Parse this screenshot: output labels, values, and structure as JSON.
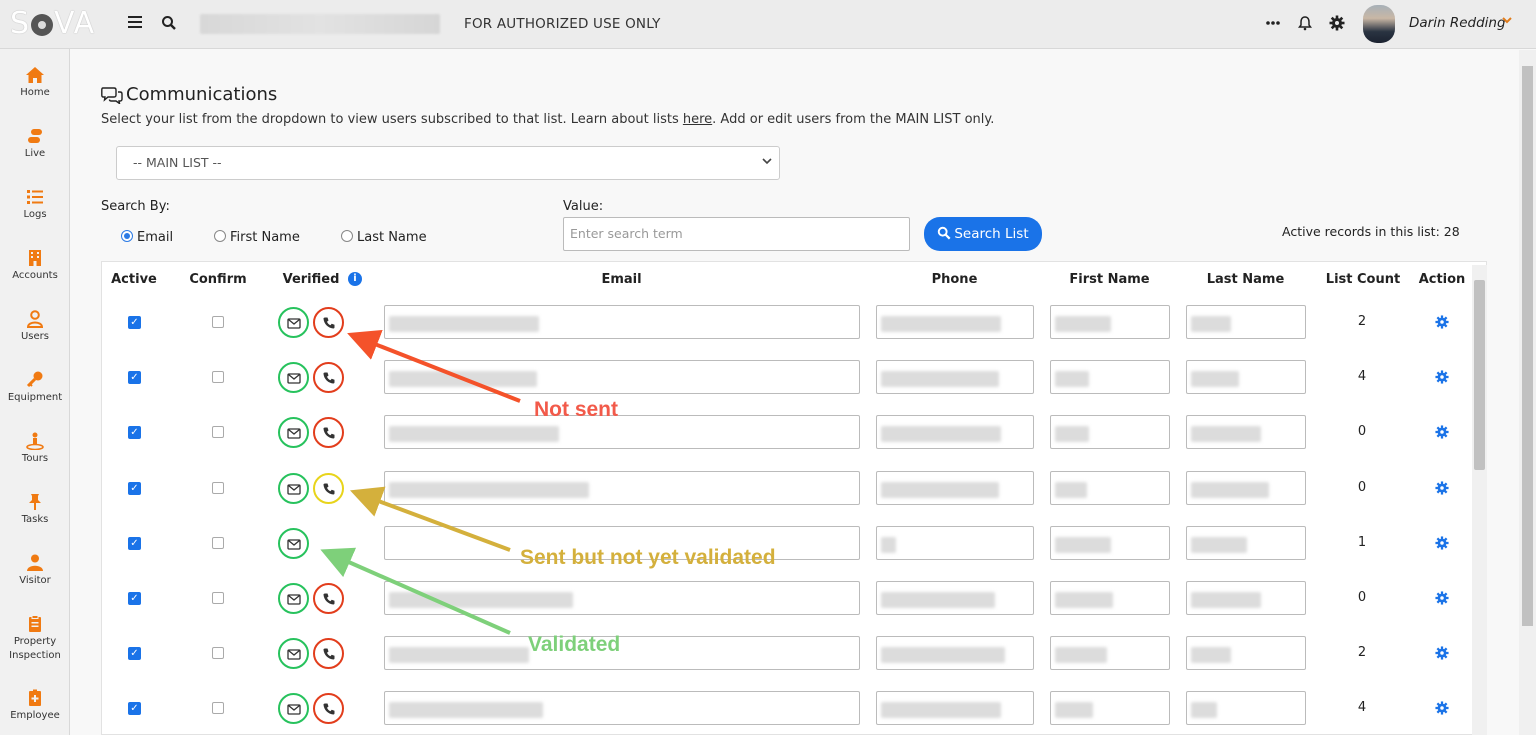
{
  "header": {
    "logo": "SOVA",
    "notice": "FOR AUTHORIZED USE ONLY",
    "user_name": "Darin Redding",
    "icons": [
      "hamburger-icon",
      "search-icon",
      "more-icon",
      "bell-icon",
      "gear-icon",
      "chevron-down-icon"
    ]
  },
  "sidebar": {
    "items": [
      {
        "label": "Home",
        "icon": "home-icon"
      },
      {
        "label": "Live",
        "icon": "live-icon"
      },
      {
        "label": "Logs",
        "icon": "logs-icon"
      },
      {
        "label": "Accounts",
        "icon": "building-icon"
      },
      {
        "label": "Users",
        "icon": "user-icon"
      },
      {
        "label": "Equipment",
        "icon": "key-icon"
      },
      {
        "label": "Tours",
        "icon": "tours-icon"
      },
      {
        "label": "Tasks",
        "icon": "pin-icon"
      },
      {
        "label": "Visitor",
        "icon": "visitor-icon"
      },
      {
        "label": "Property Inspection",
        "icon": "clipboard-icon"
      },
      {
        "label": "Employee",
        "icon": "employee-icon"
      }
    ]
  },
  "page": {
    "title": "Communications",
    "subtitle_pre": "Select your list from the dropdown to view users subscribed to that list. Learn about lists ",
    "subtitle_link": "here",
    "subtitle_post": ". Add or edit users from the MAIN LIST only.",
    "list_select": "-- MAIN LIST --",
    "search_by_label": "Search By:",
    "search_options": [
      "Email",
      "First Name",
      "Last Name"
    ],
    "search_selected": "Email",
    "value_label": "Value:",
    "value_placeholder": "Enter search term",
    "search_button": "Search List",
    "active_records": "Active records in this list: 28"
  },
  "table": {
    "columns": [
      "Active",
      "Confirm",
      "Verified",
      "Email",
      "Phone",
      "First Name",
      "Last Name",
      "List Count",
      "Action"
    ],
    "rows": [
      {
        "active": true,
        "confirm": false,
        "email_verified": true,
        "phone_status": "not-sent",
        "list_count": "2"
      },
      {
        "active": true,
        "confirm": false,
        "email_verified": true,
        "phone_status": "not-sent",
        "list_count": "4"
      },
      {
        "active": true,
        "confirm": false,
        "email_verified": true,
        "phone_status": "not-sent",
        "list_count": "0"
      },
      {
        "active": true,
        "confirm": false,
        "email_verified": true,
        "phone_status": "sent-not-validated",
        "list_count": "0"
      },
      {
        "active": true,
        "confirm": false,
        "email_verified": true,
        "phone_status": "validated",
        "list_count": "1"
      },
      {
        "active": true,
        "confirm": false,
        "email_verified": true,
        "phone_status": "not-sent",
        "list_count": "0"
      },
      {
        "active": true,
        "confirm": false,
        "email_verified": true,
        "phone_status": "not-sent",
        "list_count": "2"
      },
      {
        "active": true,
        "confirm": false,
        "email_verified": true,
        "phone_status": "not-sent",
        "list_count": "4"
      }
    ]
  },
  "annotations": [
    {
      "text": "Not sent",
      "color": "#f25a4a"
    },
    {
      "text": "Sent but not yet validated",
      "color": "#d4b03c"
    },
    {
      "text": "Validated",
      "color": "#7ed07a"
    }
  ],
  "colors": {
    "accent": "#1a73e8",
    "sidebar_icon": "#f07a12",
    "status_green": "#27c25d",
    "status_red": "#e23d1c",
    "status_yellow": "#e8d41b"
  }
}
